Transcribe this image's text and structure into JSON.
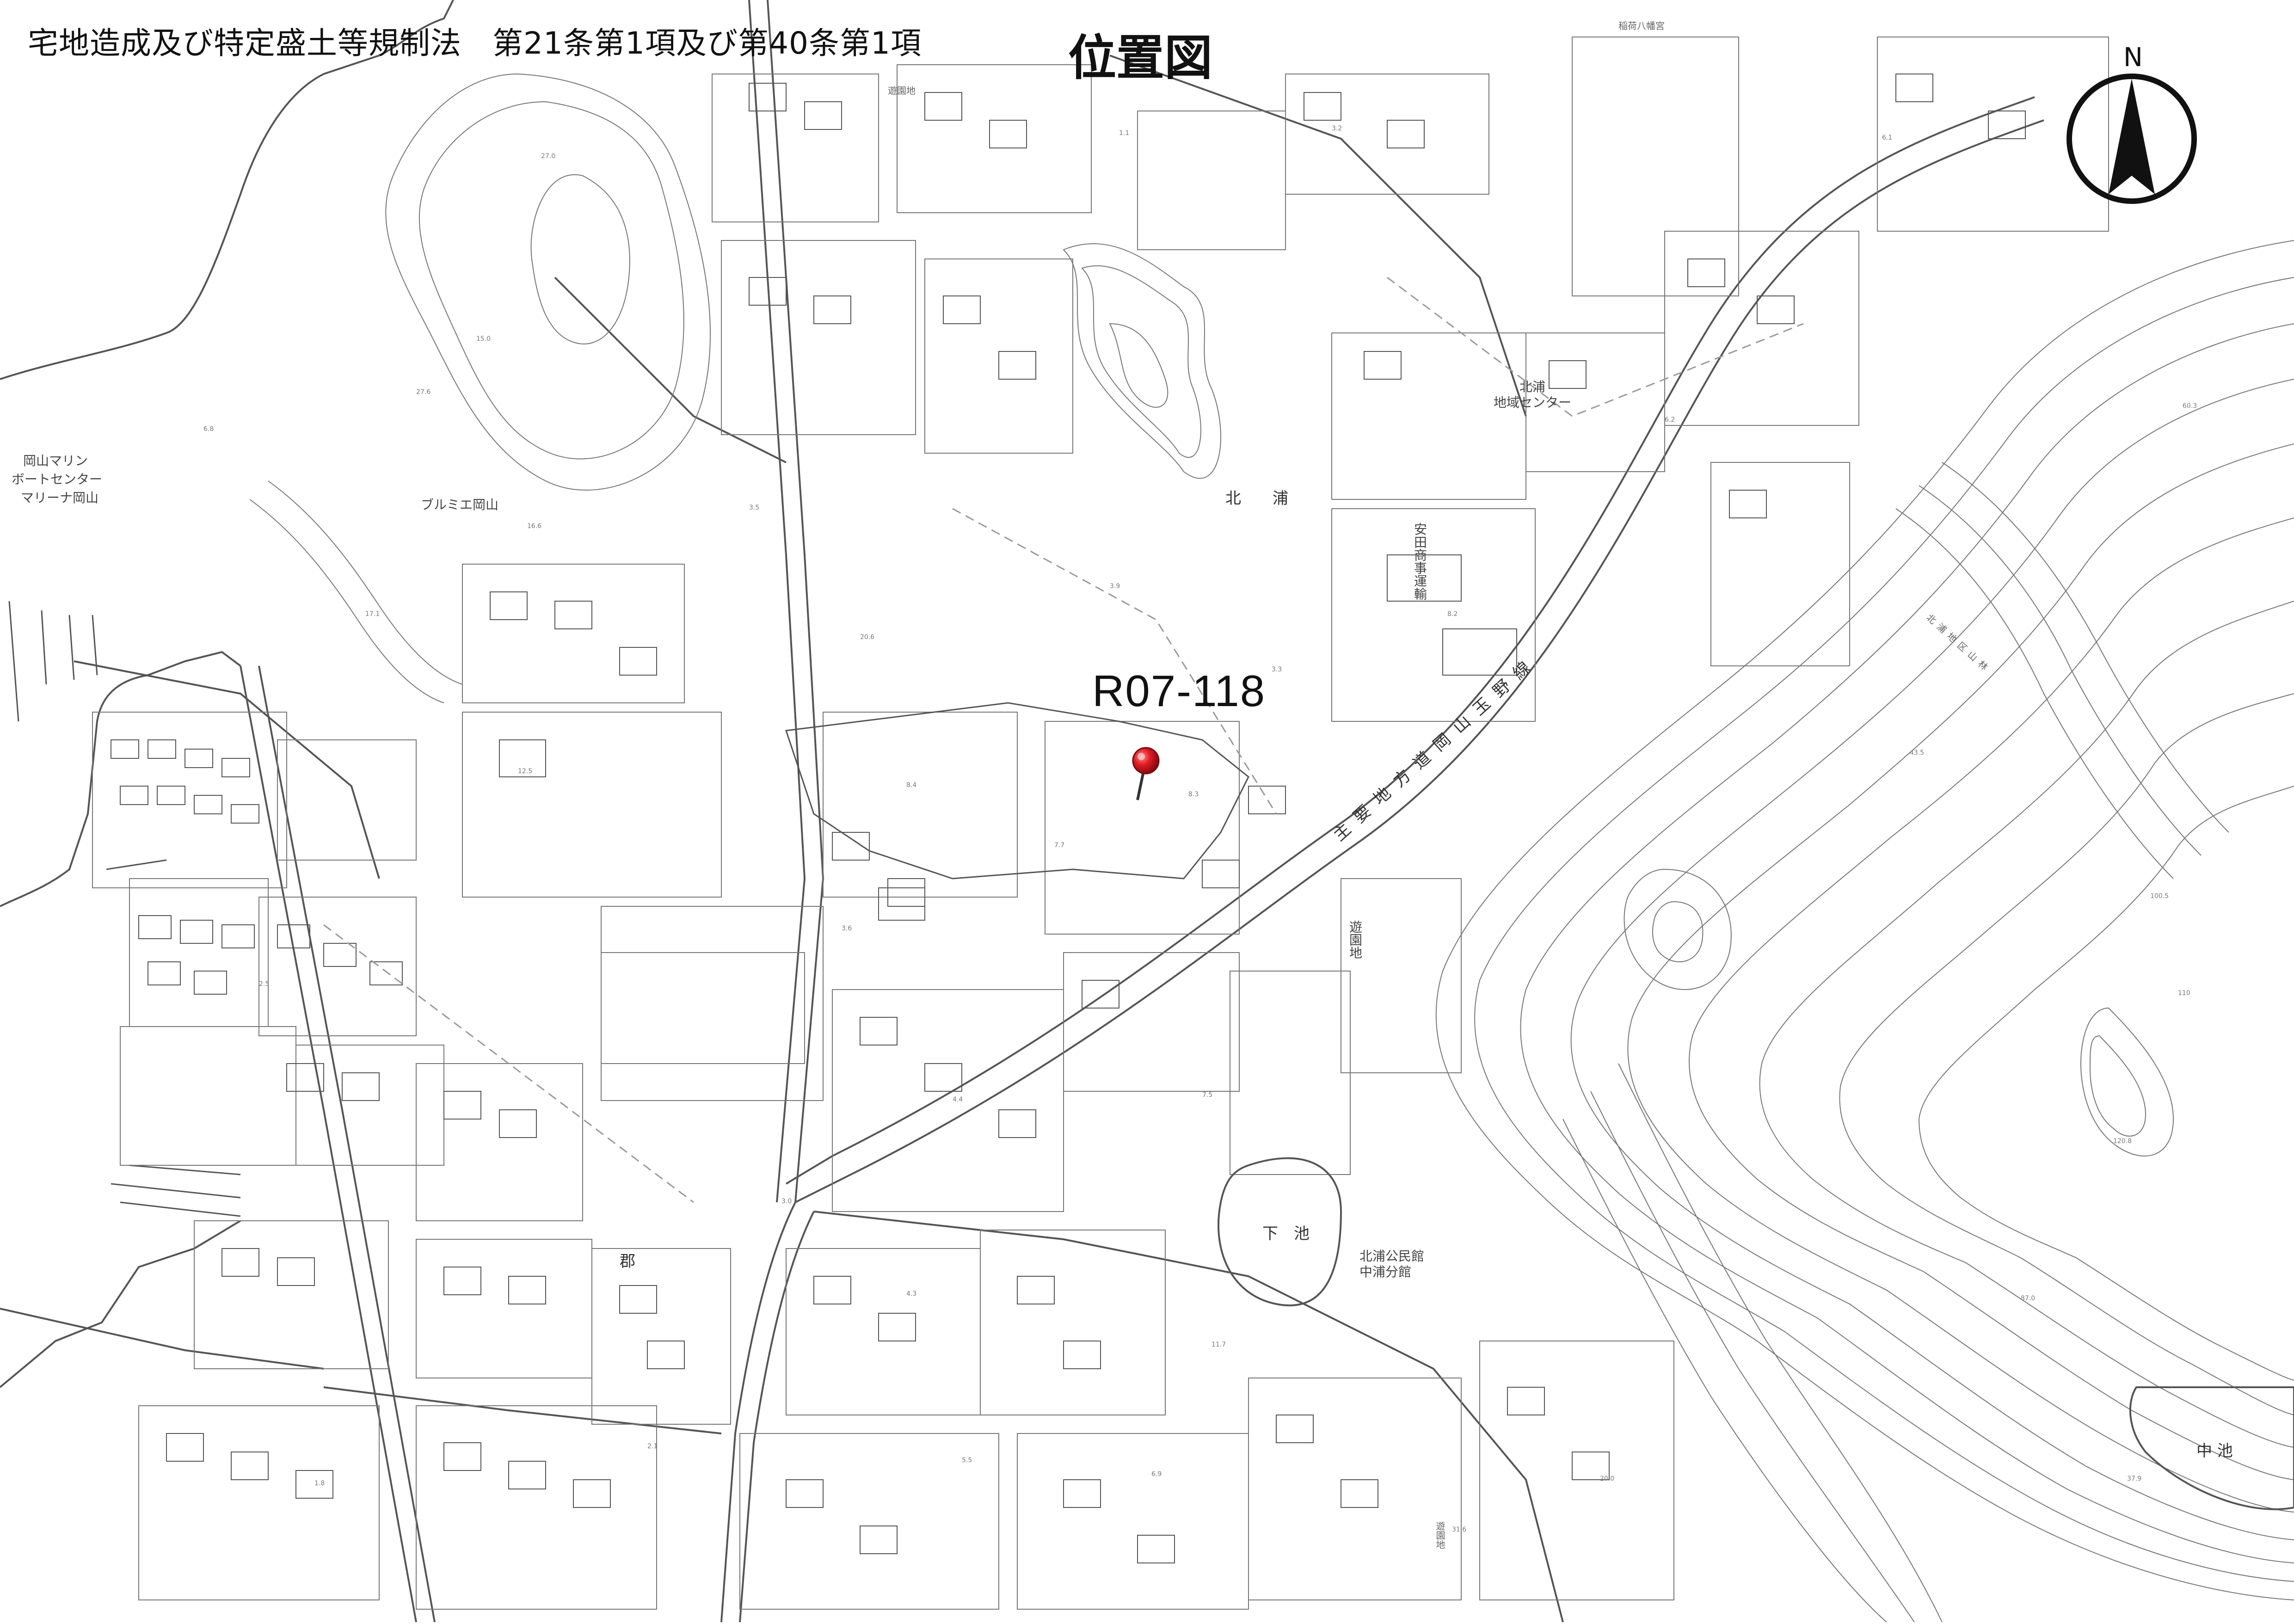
{
  "header": {
    "law_caption": "宅地造成及び特定盛土等規制法　第21条第1項及び第40条第1項",
    "title": "位置図"
  },
  "site": {
    "id": "R07-118",
    "marker_color": "#d0141c"
  },
  "north_arrow": {
    "label": "N"
  },
  "places": {
    "marine_center": [
      "岡山マリン",
      "ボートセンター",
      "マリーナ岡山"
    ],
    "brumie": "ブルミエ岡山",
    "kitaura": "北　　浦",
    "yasuda": "安田商事運輸",
    "community": "北浦\n地域センター",
    "shrine": "稲荷八幡宮",
    "park_n": "遊園地",
    "park_s": "遊園地",
    "shimoike": "下　池",
    "nakaike": "中 池",
    "kori": "郡",
    "kitaura_hall": "北浦公民館\n中浦分館",
    "route": "主要地方道岡山玉野線",
    "area_right": "北浦地区山林",
    "south_park": "遊園地"
  },
  "spot_heights": [
    "27.0",
    "27.6",
    "15.0",
    "16.6",
    "17.1",
    "12.5",
    "20.6",
    "8.4",
    "7.7",
    "8.3",
    "3.9",
    "3.3",
    "8.2",
    "6.8",
    "6.2",
    "6.1",
    "3.2",
    "4.4",
    "3.0",
    "4.3",
    "7.5",
    "11.7",
    "6.9",
    "5.5",
    "20.0",
    "37.9",
    "31.6",
    "43.5",
    "100.5",
    "120.8",
    "110",
    "87.0",
    "60.3",
    "3.5",
    "3.6",
    "2.1",
    "1.8",
    "1.1",
    "2.5"
  ],
  "colors": {
    "line": "#555555",
    "line_light": "#9a9a9a",
    "contour": "#777777",
    "marker": "#d0141c",
    "marker_dark": "#7a0a0e"
  }
}
